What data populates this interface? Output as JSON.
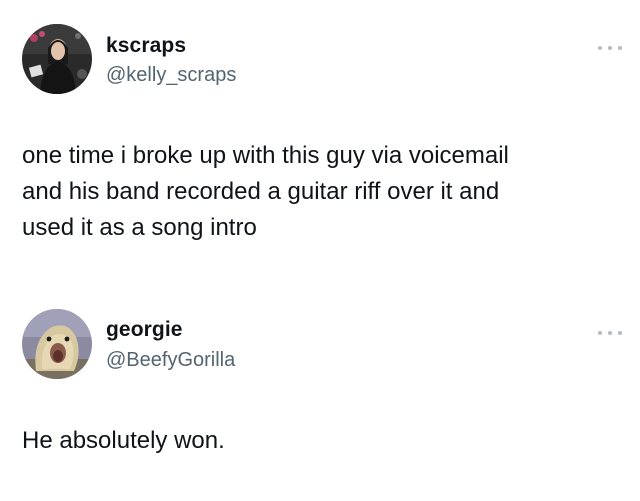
{
  "tweets": [
    {
      "display_name": "kscraps",
      "handle": "@kelly_scraps",
      "text": "one time i broke up with this guy via voicemail\nand his band recorded a guitar riff over it and\nused it as a song intro",
      "avatar": "profile-photo"
    },
    {
      "display_name": "georgie",
      "handle": "@BeefyGorilla",
      "text": "He absolutely won.",
      "avatar": "profile-photo"
    }
  ],
  "icons": {
    "more": "more-options-icon"
  }
}
